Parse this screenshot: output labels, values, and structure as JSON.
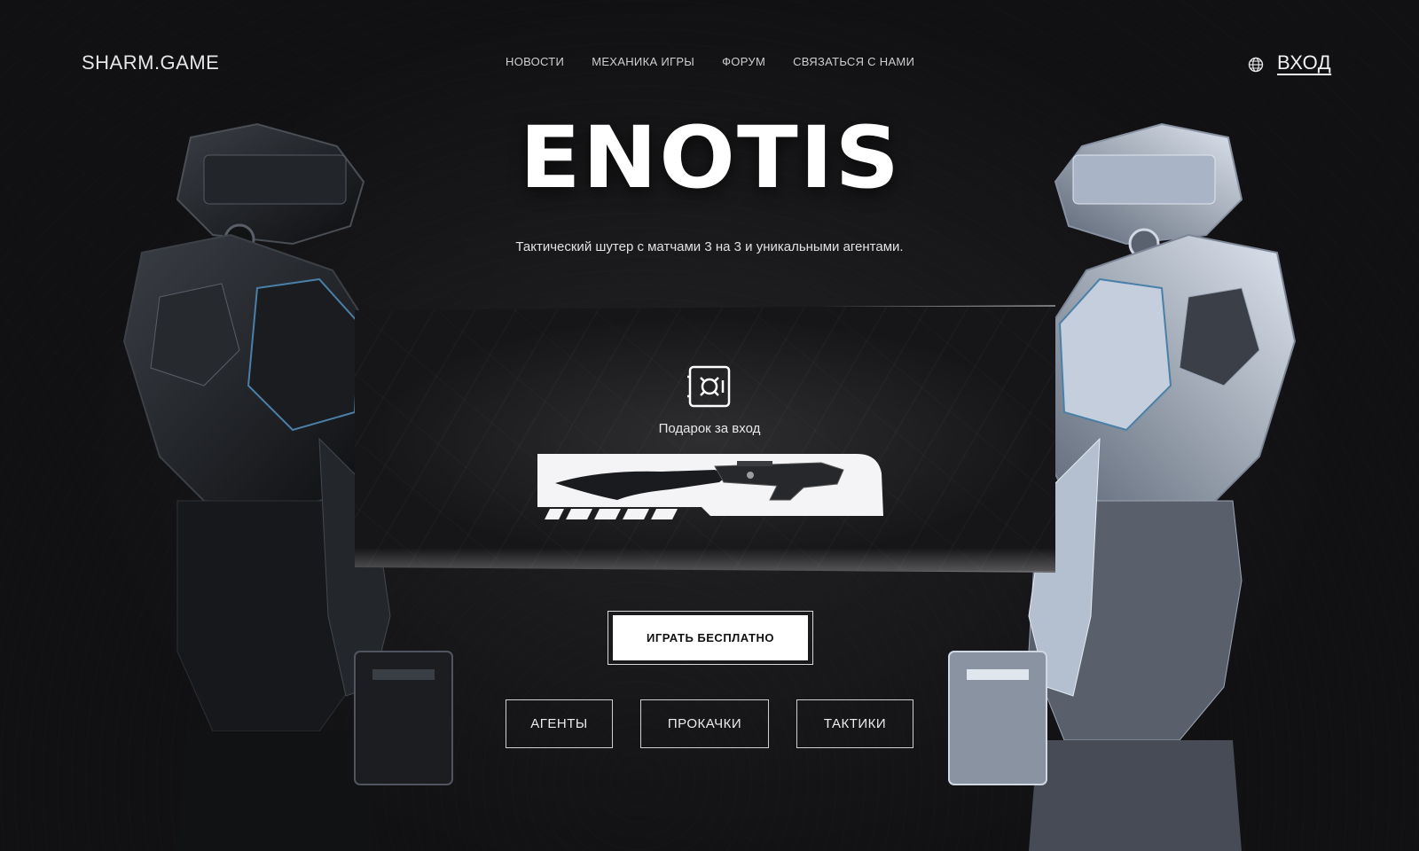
{
  "header": {
    "logo": "SHARM.GAME",
    "nav": [
      {
        "label": "НОВОСТИ"
      },
      {
        "label": "МЕХАНИКА ИГРЫ"
      },
      {
        "label": "ФОРУМ"
      },
      {
        "label": "СВЯЗАТЬСЯ С НАМИ"
      }
    ],
    "language_icon": "globe-icon",
    "login": "ВХОД"
  },
  "hero": {
    "title": "ENOTIS",
    "subtitle": "Тактический шутер с матчами 3 на 3 и уникальными агентами."
  },
  "gift": {
    "icon": "safe-icon",
    "label": "Подарок за вход",
    "item_image": "knife-gun-icon"
  },
  "buttons": {
    "play": "ИГРАТЬ БЕСПЛАТНО",
    "secondary": [
      {
        "label": "АГЕНТЫ"
      },
      {
        "label": "ПРОКАЧКИ"
      },
      {
        "label": "ТАКТИКИ"
      }
    ]
  },
  "colors": {
    "background": "#141416",
    "accent": "#ffffff",
    "armor_dark": "#1e2126",
    "armor_light": "#b9c4d6",
    "armor_blue_trim": "#4a7fa8"
  }
}
